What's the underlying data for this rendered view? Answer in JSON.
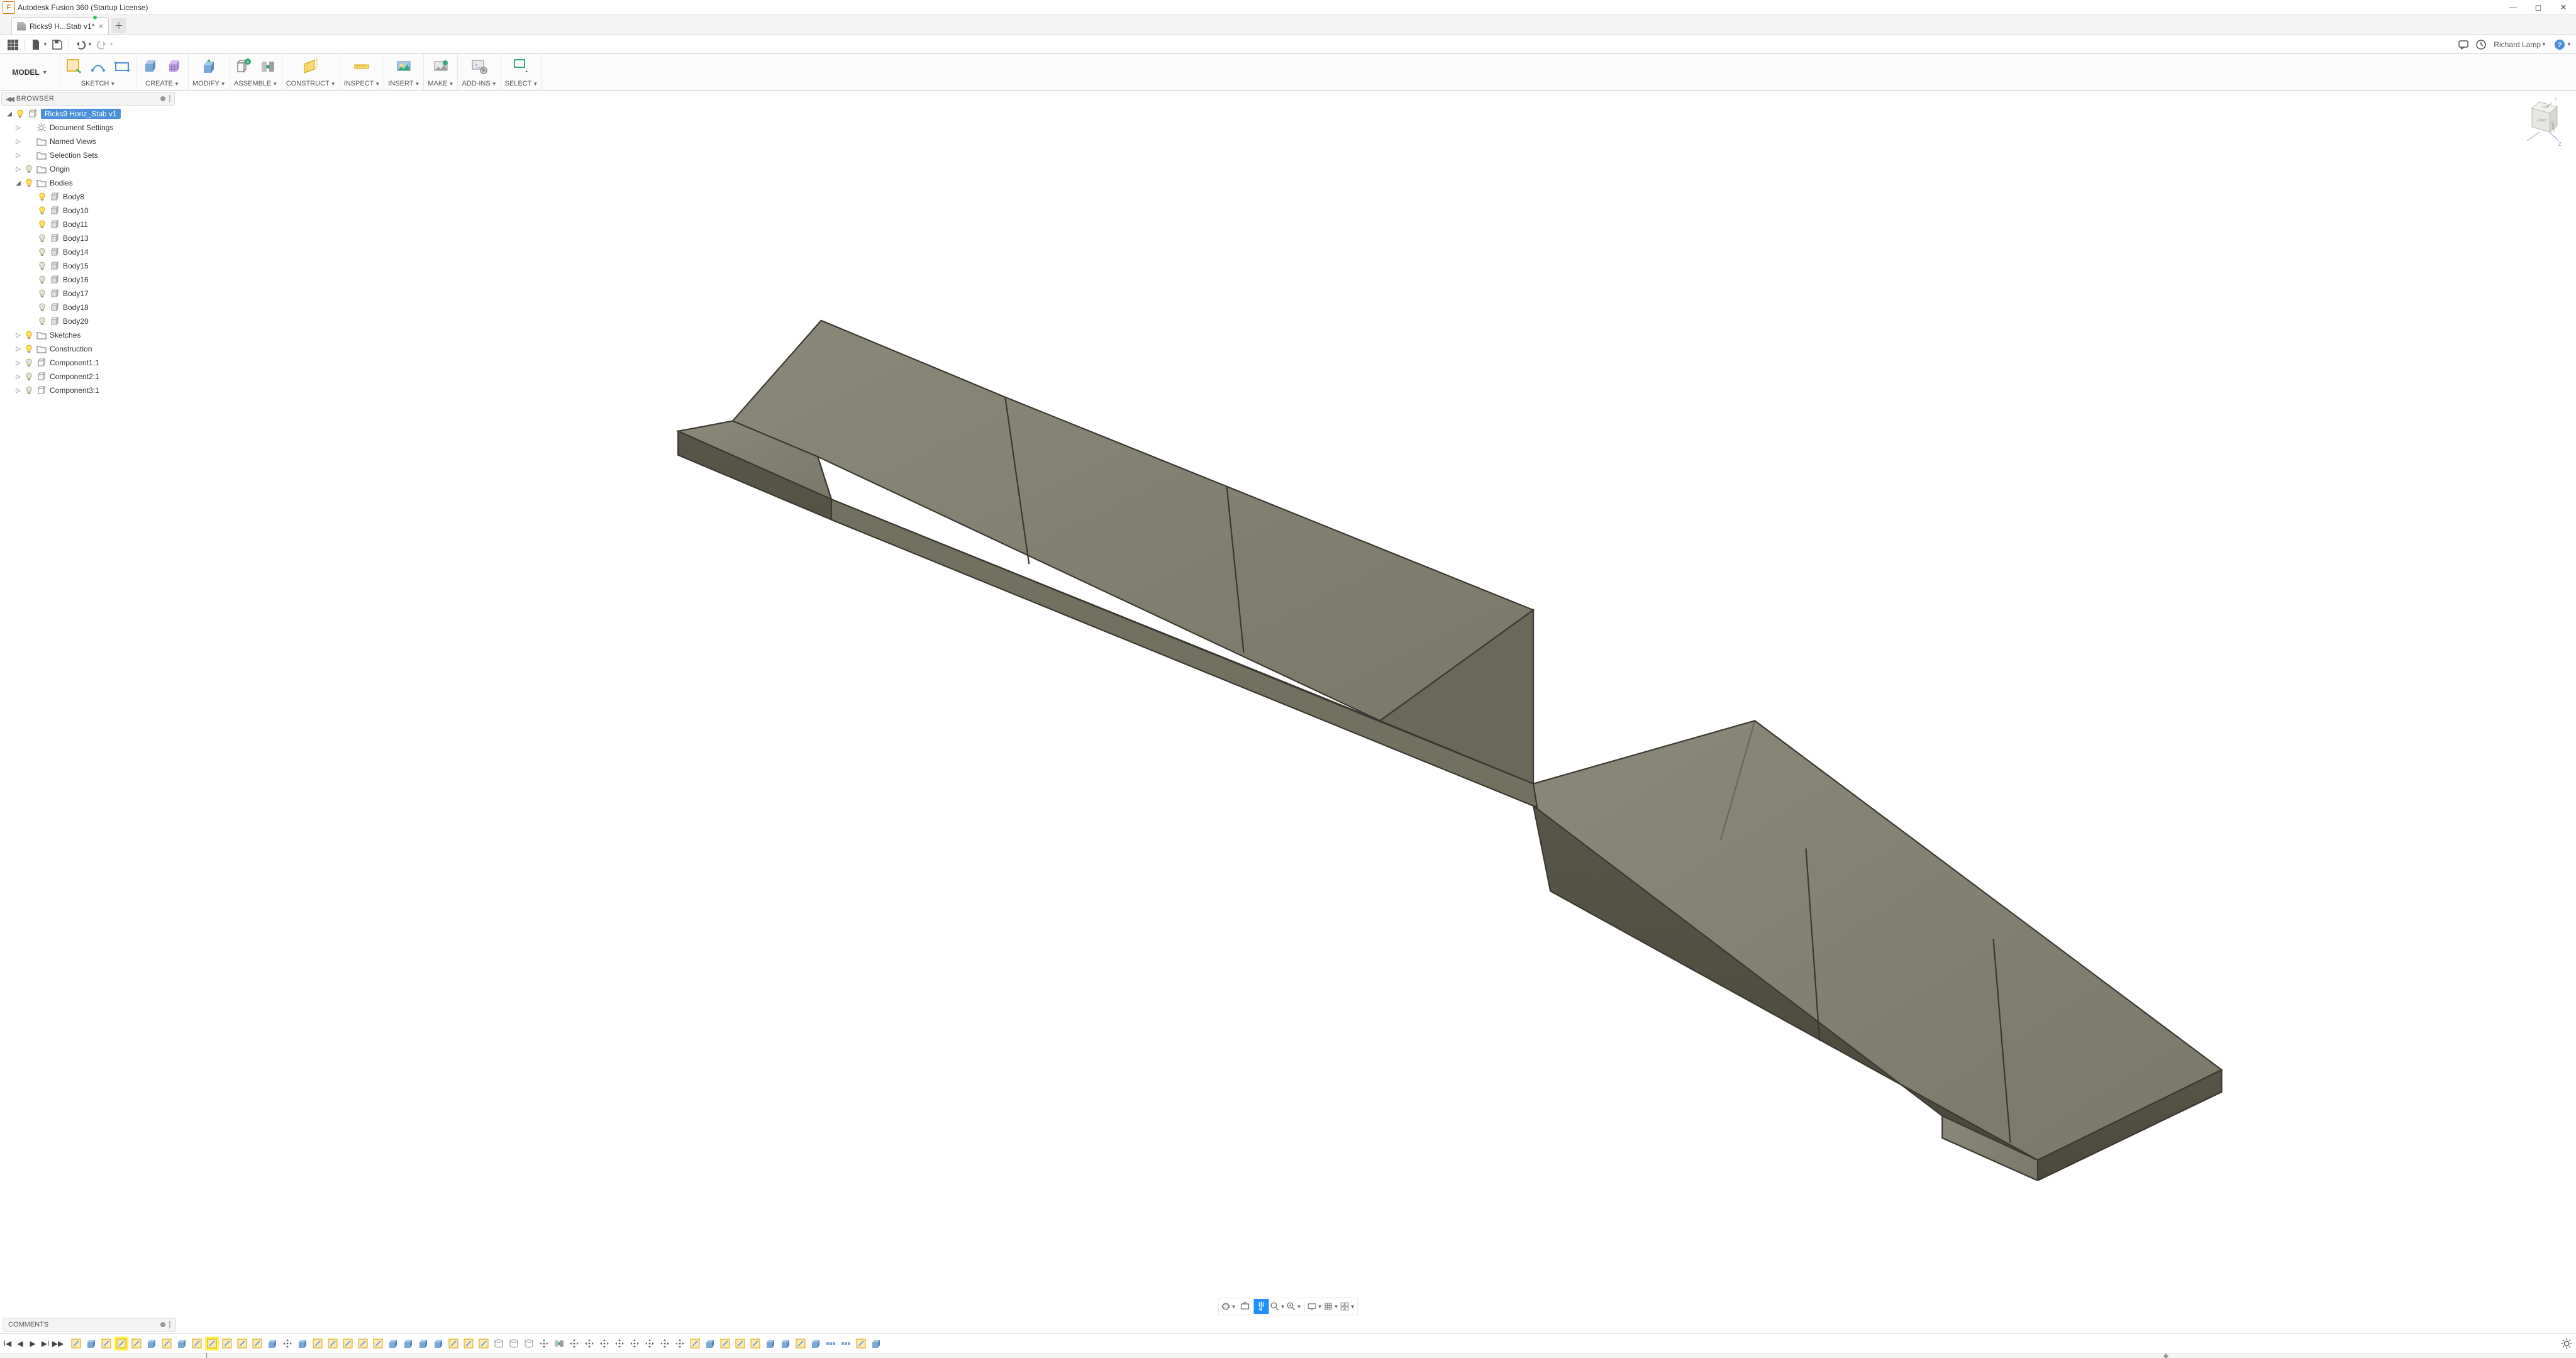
{
  "app": {
    "title": "Autodesk Fusion 360 (Startup License)",
    "icon_letter": "F"
  },
  "tab": {
    "label": "Ricks9 H...Stab v1*",
    "unsaved": true
  },
  "user": {
    "name": "Richard Lamp"
  },
  "workspace": {
    "label": "MODEL"
  },
  "ribbon": [
    {
      "label": "SKETCH"
    },
    {
      "label": "CREATE"
    },
    {
      "label": "MODIFY"
    },
    {
      "label": "ASSEMBLE"
    },
    {
      "label": "CONSTRUCT"
    },
    {
      "label": "INSPECT"
    },
    {
      "label": "INSERT"
    },
    {
      "label": "MAKE"
    },
    {
      "label": "ADD-INS"
    },
    {
      "label": "SELECT"
    }
  ],
  "browser": {
    "title": "BROWSER",
    "root": "Ricks9 Horiz_Stab v1",
    "items": [
      {
        "label": "Document Settings",
        "icon": "gear",
        "exp": "▷",
        "bulb": null
      },
      {
        "label": "Named Views",
        "icon": "folder",
        "exp": "▷",
        "bulb": null
      },
      {
        "label": "Selection Sets",
        "icon": "folder",
        "exp": "▷",
        "bulb": null
      },
      {
        "label": "Origin",
        "icon": "folder",
        "exp": "▷",
        "bulb": "off"
      },
      {
        "label": "Bodies",
        "icon": "folder",
        "exp": "◢",
        "bulb": "on",
        "children": [
          {
            "label": "Body8",
            "bulb": "on"
          },
          {
            "label": "Body10",
            "bulb": "on"
          },
          {
            "label": "Body11",
            "bulb": "on"
          },
          {
            "label": "Body13",
            "bulb": "off"
          },
          {
            "label": "Body14",
            "bulb": "off"
          },
          {
            "label": "Body15",
            "bulb": "off"
          },
          {
            "label": "Body16",
            "bulb": "off"
          },
          {
            "label": "Body17",
            "bulb": "off"
          },
          {
            "label": "Body18",
            "bulb": "off"
          },
          {
            "label": "Body20",
            "bulb": "off"
          }
        ]
      },
      {
        "label": "Sketches",
        "icon": "folder",
        "exp": "▷",
        "bulb": "on"
      },
      {
        "label": "Construction",
        "icon": "folder",
        "exp": "▷",
        "bulb": "on"
      },
      {
        "label": "Component1:1",
        "icon": "comp",
        "exp": "▷",
        "bulb": "off"
      },
      {
        "label": "Component2:1",
        "icon": "comp",
        "exp": "▷",
        "bulb": "off"
      },
      {
        "label": "Component3:1",
        "icon": "comp",
        "exp": "▷",
        "bulb": "off"
      }
    ]
  },
  "comments": {
    "title": "COMMENTS"
  },
  "viewcube": {
    "top": "TOP",
    "front": "FRONT",
    "left": "LEFT",
    "y": "Y",
    "z": "Z"
  },
  "timeline": {
    "count": 54,
    "highlights": [
      3,
      9
    ],
    "markers": [
      0.84
    ]
  }
}
